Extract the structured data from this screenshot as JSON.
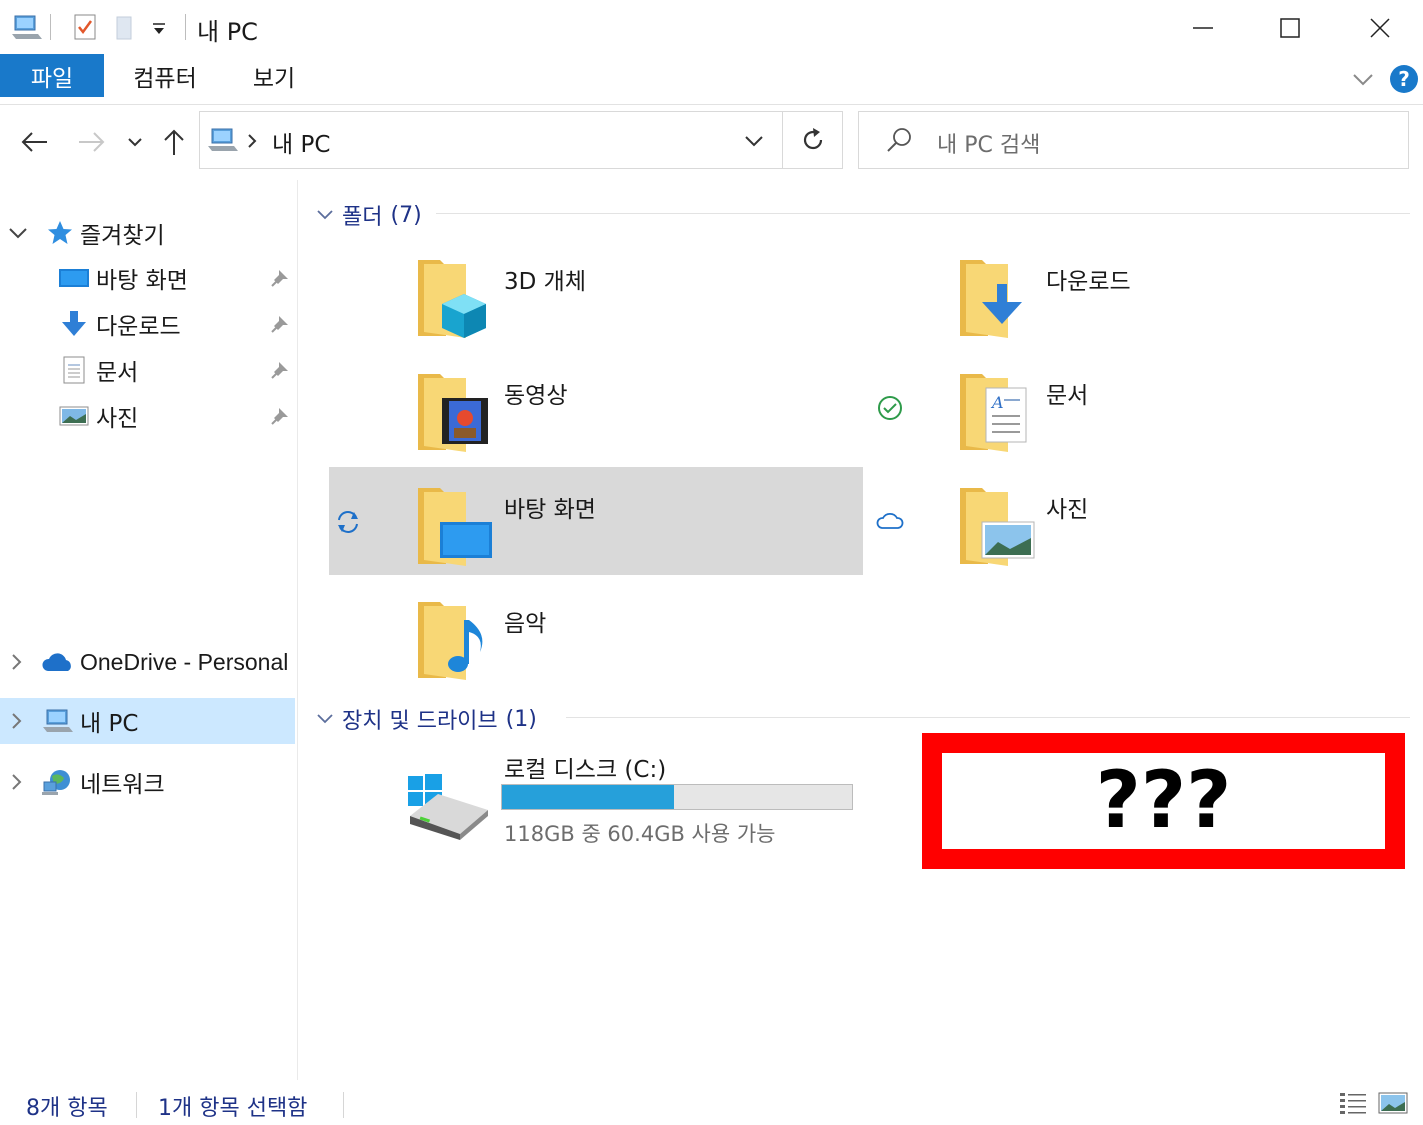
{
  "window": {
    "title": "내 PC",
    "controls": {
      "minimize": "minimize-icon",
      "maximize": "maximize-icon",
      "close": "close-icon"
    }
  },
  "ribbon": {
    "tabs": [
      "파일",
      "컴퓨터",
      "보기"
    ],
    "active_tab": "파일"
  },
  "address": {
    "crumb": "내 PC",
    "search_placeholder": "내 PC 검색"
  },
  "nav": {
    "quick_access": "즐겨찾기",
    "pinned": [
      {
        "label": "바탕 화면",
        "icon": "desktop-icon"
      },
      {
        "label": "다운로드",
        "icon": "download-icon"
      },
      {
        "label": "문서",
        "icon": "document-icon"
      },
      {
        "label": "사진",
        "icon": "pictures-icon"
      }
    ],
    "onedrive": "OneDrive - Personal",
    "this_pc": "내 PC",
    "network": "네트워크"
  },
  "folders": {
    "header": "폴더",
    "count": "(7)",
    "items": [
      {
        "label": "3D 개체",
        "icon": "3d-objects-folder-icon"
      },
      {
        "label": "다운로드",
        "icon": "downloads-folder-icon"
      },
      {
        "label": "동영상",
        "icon": "videos-folder-icon"
      },
      {
        "label": "문서",
        "icon": "documents-folder-icon"
      },
      {
        "label": "바탕 화면",
        "icon": "desktop-folder-icon"
      },
      {
        "label": "사진",
        "icon": "pictures-folder-icon"
      },
      {
        "label": "음악",
        "icon": "music-folder-icon"
      }
    ]
  },
  "drives": {
    "header": "장치 및 드라이브",
    "count": "(1)",
    "items": [
      {
        "label": "로컬 디스크 (C:)",
        "free_text": "118GB 중 60.4GB 사용 가능",
        "used_fraction": 0.49
      }
    ]
  },
  "placeholder_box": {
    "text": "???",
    "border_color": "#ff0000"
  },
  "status": {
    "items": "8개 항목",
    "selected": "1개 항목 선택함"
  },
  "colors": {
    "accent": "#1979ca",
    "selection": "#cce8ff",
    "folder": "#f8d775",
    "group_text": "#1e3287",
    "drive_bar": "#26a0da"
  }
}
